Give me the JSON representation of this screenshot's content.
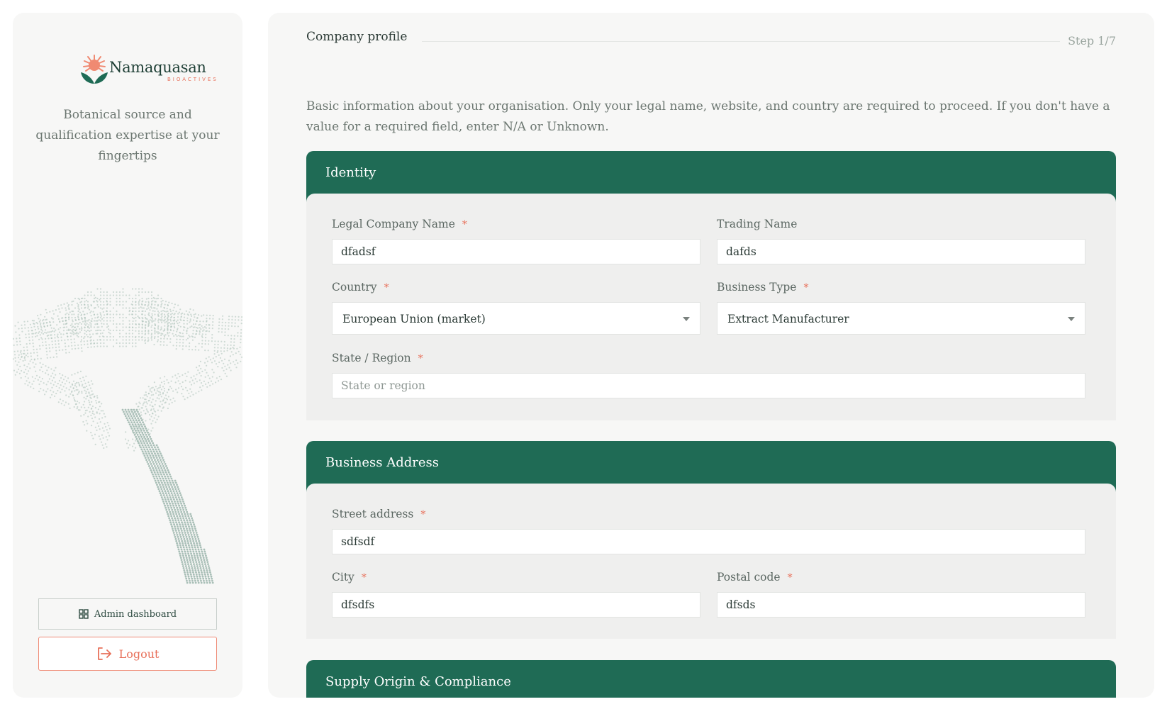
{
  "brand": {
    "name": "Namaquasan",
    "sub": "BIOACTIVES",
    "tagline": "Botanical source and qualification expertise at your fingertips"
  },
  "nav": {
    "admin_label": "Admin dashboard",
    "logout_label": "Logout"
  },
  "header": {
    "title": "Company profile",
    "step": "Step 1/7"
  },
  "intro": "Basic information about your organisation. Only your legal name, website, and country are required to proceed. If you don't have a value for a required field, enter N/A or Unknown.",
  "required_marker": "*",
  "sections": {
    "identity": {
      "title": "Identity",
      "legal_name": {
        "label": "Legal Company Name",
        "value": "dfadsf",
        "required": true
      },
      "trading_name": {
        "label": "Trading Name",
        "value": "dafds",
        "required": false
      },
      "country": {
        "label": "Country",
        "value": "European Union (market)",
        "required": true
      },
      "business_type": {
        "label": "Business Type",
        "value": "Extract Manufacturer",
        "required": true
      },
      "state_region": {
        "label": "State / Region",
        "value": "",
        "placeholder": "State or region",
        "required": true
      }
    },
    "address": {
      "title": "Business Address",
      "street": {
        "label": "Street address",
        "value": "sdfsdf",
        "required": true
      },
      "city": {
        "label": "City",
        "value": "dfsdfs",
        "required": true
      },
      "postal_code": {
        "label": "Postal code",
        "value": "dfsds",
        "required": true
      }
    },
    "supply": {
      "title": "Supply Origin & Compliance"
    }
  },
  "colors": {
    "section_header": "#1f6b55",
    "accent": "#e8705a",
    "panel": "#f7f7f6"
  }
}
